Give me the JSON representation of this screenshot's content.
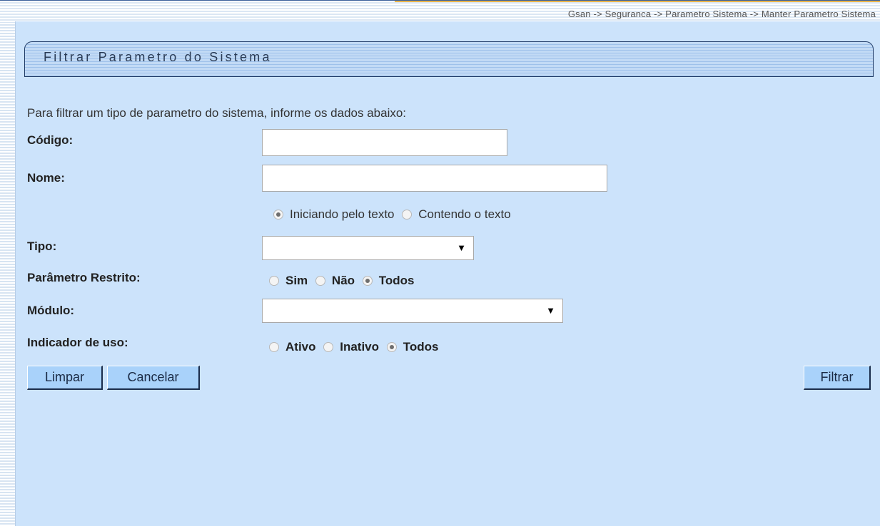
{
  "breadcrumb": "Gsan -> Seguranca -> Parametro Sistema -> Manter Parametro Sistema",
  "section_title": "Filtrar Parametro do Sistema",
  "intro_text": "Para filtrar um tipo de parametro do sistema, informe os dados abaixo:",
  "fields": {
    "codigo": {
      "label": "Código:",
      "value": ""
    },
    "nome": {
      "label": "Nome:",
      "value": ""
    },
    "nome_match": {
      "options": [
        "Iniciando pelo texto",
        "Contendo o texto"
      ],
      "selected": "Iniciando pelo texto"
    },
    "tipo": {
      "label": "Tipo:",
      "selected_value": ""
    },
    "parametro_restrito": {
      "label": "Parâmetro Restrito:",
      "options": [
        "Sim",
        "Não",
        "Todos"
      ],
      "selected": "Todos"
    },
    "modulo": {
      "label": "Módulo:",
      "selected_value": ""
    },
    "indicador_uso": {
      "label": "Indicador de uso:",
      "options": [
        "Ativo",
        "Inativo",
        "Todos"
      ],
      "selected": "Todos"
    }
  },
  "buttons": {
    "limpar": "Limpar",
    "cancelar": "Cancelar",
    "filtrar": "Filtrar"
  },
  "icons": {
    "dropdown_arrow": "▼"
  },
  "colors": {
    "panel_bg": "#cce3fb",
    "button_bg": "#a9d2fa",
    "title_border": "#1f3a66"
  }
}
